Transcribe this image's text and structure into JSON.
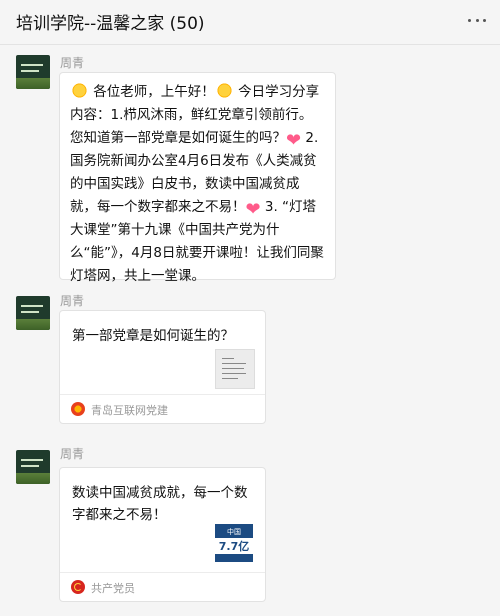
{
  "window": {
    "title": "培训学院--温馨之家 (50)"
  },
  "messages": [
    {
      "sender": "周青",
      "text_parts": [
        {
          "type": "emoji",
          "icon": "sun-icon"
        },
        {
          "type": "text",
          "value": " 各位老师，上午好！"
        },
        {
          "type": "emoji",
          "icon": "sun-icon"
        },
        {
          "type": "text",
          "value": " 今日学习分享内容：1.栉风沐雨，鲜红党章引领前行。您知道第一部党章是如何诞生的吗？"
        },
        {
          "type": "emoji",
          "icon": "heart-icon"
        },
        {
          "type": "text",
          "value": " 2.国务院新闻办公室4月6日发布《人类减贫的中国实践》白皮书，数读中国减贫成就，每一个数字都来之不易！"
        },
        {
          "type": "emoji",
          "icon": "heart-icon"
        },
        {
          "type": "text",
          "value": " 3. “灯塔大课堂”第十九课《中国共产党为什么“能”》，4月8日就要开课啦！让我们同聚灯塔网，共上一堂课。"
        }
      ]
    },
    {
      "sender": "周青",
      "card_title": "第一部党章是如何诞生的？",
      "source": "青岛互联网党建"
    },
    {
      "sender": "周青",
      "card_title": "数读中国减贫成就，每一个数字都来之不易！",
      "thumb_top": "中国",
      "thumb_num": "7.7亿",
      "source": "共产党员"
    }
  ],
  "colors": {
    "party_red": "#d7261e",
    "thumb_blue": "#1c4b82"
  }
}
